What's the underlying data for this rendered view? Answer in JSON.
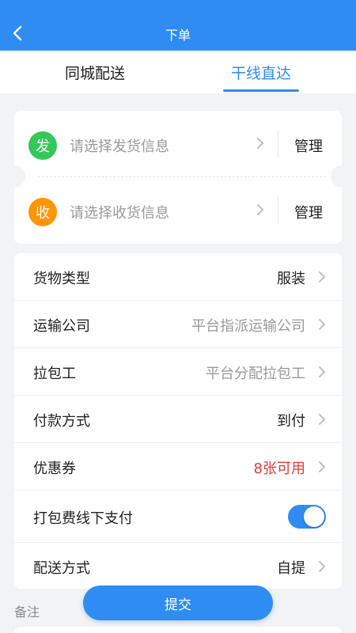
{
  "navbar": {
    "title": "下单",
    "back_icon": "chevron-left-icon"
  },
  "tabs": [
    {
      "label": "同城配送",
      "active": false
    },
    {
      "label": "干线直达",
      "active": true
    }
  ],
  "address": {
    "sender": {
      "badge": "发",
      "placeholder": "请选择发货信息",
      "manage_label": "管理",
      "badge_color": "#34c759"
    },
    "receiver": {
      "badge": "收",
      "placeholder": "请选择收货信息",
      "manage_label": "管理",
      "badge_color": "#ff9500"
    }
  },
  "form": {
    "rows": [
      {
        "label": "货物类型",
        "value": "服装"
      },
      {
        "label": "运输公司",
        "value": "平台指派运输公司"
      },
      {
        "label": "拉包工",
        "value": "平台分配拉包工"
      },
      {
        "label": "付款方式",
        "value": "到付"
      },
      {
        "label": "优惠券",
        "value": "8张可用"
      },
      {
        "label": "打包费线下支付",
        "toggle_on": true
      },
      {
        "label": "配送方式",
        "value": "自提"
      }
    ]
  },
  "remark_label": "备注",
  "submit_label": "提交",
  "colors": {
    "primary": "#2f8cf2",
    "coupon": "#e63a3a",
    "page_bg": "#f2f3f5"
  }
}
